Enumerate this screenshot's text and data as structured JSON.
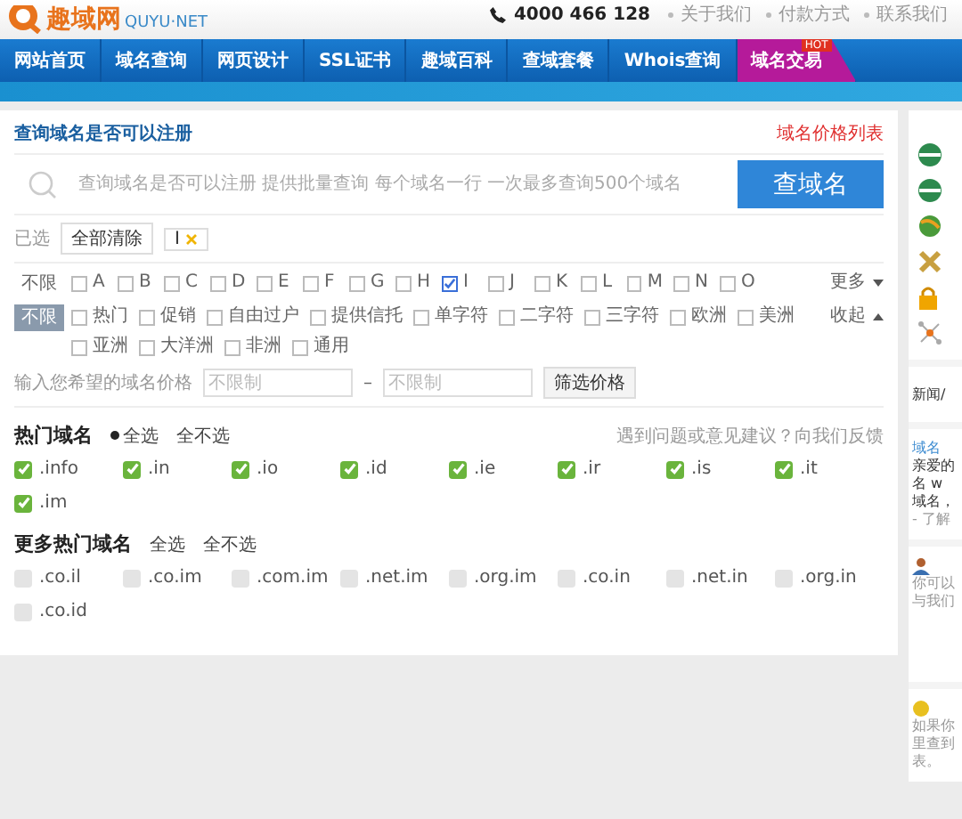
{
  "header": {
    "logo_text": "趣域网",
    "logo_sub": "QUYU·NET",
    "phone": "4000 466 128",
    "links": [
      "关于我们",
      "付款方式",
      "联系我们"
    ]
  },
  "nav": [
    {
      "label": "网站首页",
      "selected": false
    },
    {
      "label": "域名查询",
      "selected": false
    },
    {
      "label": "网页设计",
      "selected": false
    },
    {
      "label": "SSL证书",
      "selected": false
    },
    {
      "label": "趣域百科",
      "selected": false
    },
    {
      "label": "查域套餐",
      "selected": false
    },
    {
      "label": "Whois查询",
      "selected": false
    },
    {
      "label": "域名交易",
      "selected": true,
      "badge": "HOT"
    }
  ],
  "search": {
    "title": "查询域名是否可以注册",
    "price_link": "域名价格列表",
    "placeholder": "查询域名是否可以注册 提供批量查询 每个域名一行 一次最多查询500个域名",
    "button": "查域名"
  },
  "selected_filters": {
    "label": "已选",
    "clear": "全部清除",
    "tags": [
      "I"
    ]
  },
  "letter_filter": {
    "any": {
      "label": "不限",
      "selected": false
    },
    "toggle": {
      "label": "更多",
      "expanded": false
    },
    "items": [
      {
        "label": "A",
        "checked": false
      },
      {
        "label": "B",
        "checked": false
      },
      {
        "label": "C",
        "checked": false
      },
      {
        "label": "D",
        "checked": false
      },
      {
        "label": "E",
        "checked": false
      },
      {
        "label": "F",
        "checked": false
      },
      {
        "label": "G",
        "checked": false
      },
      {
        "label": "H",
        "checked": false
      },
      {
        "label": "I",
        "checked": true
      },
      {
        "label": "J",
        "checked": false
      },
      {
        "label": "K",
        "checked": false
      },
      {
        "label": "L",
        "checked": false
      },
      {
        "label": "M",
        "checked": false
      },
      {
        "label": "N",
        "checked": false
      },
      {
        "label": "O",
        "checked": false
      }
    ]
  },
  "category_filter": {
    "any": {
      "label": "不限",
      "selected": true
    },
    "toggle": {
      "label": "收起",
      "expanded": true
    },
    "items": [
      {
        "label": "热门",
        "checked": false
      },
      {
        "label": "促销",
        "checked": false
      },
      {
        "label": "自由过户",
        "checked": false
      },
      {
        "label": "提供信托",
        "checked": false
      },
      {
        "label": "单字符",
        "checked": false
      },
      {
        "label": "二字符",
        "checked": false
      },
      {
        "label": "三字符",
        "checked": false
      },
      {
        "label": "欧洲",
        "checked": false
      },
      {
        "label": "美洲",
        "checked": false
      },
      {
        "label": "亚洲",
        "checked": false
      },
      {
        "label": "大洋洲",
        "checked": false
      },
      {
        "label": "非洲",
        "checked": false
      },
      {
        "label": "通用",
        "checked": false
      }
    ]
  },
  "price_filter": {
    "label": "输入您希望的域名价格",
    "min_placeholder": "不限制",
    "separator": "–",
    "max_placeholder": "不限制",
    "button": "筛选价格"
  },
  "hot_domains": {
    "title": "热门域名",
    "options": [
      {
        "label": "全选",
        "selected": true
      },
      {
        "label": "全不选",
        "selected": false
      }
    ],
    "feedback": "遇到问题或意见建议？向我们反馈",
    "items": [
      {
        "label": ".info",
        "checked": true
      },
      {
        "label": ".in",
        "checked": true
      },
      {
        "label": ".io",
        "checked": true
      },
      {
        "label": ".id",
        "checked": true
      },
      {
        "label": ".ie",
        "checked": true
      },
      {
        "label": ".ir",
        "checked": true
      },
      {
        "label": ".is",
        "checked": true
      },
      {
        "label": ".it",
        "checked": true
      },
      {
        "label": ".im",
        "checked": true
      }
    ]
  },
  "more_domains": {
    "title": "更多热门域名",
    "options": [
      {
        "label": "全选",
        "selected": false
      },
      {
        "label": "全不选",
        "selected": false
      }
    ],
    "items": [
      {
        "label": ".co.il",
        "checked": false
      },
      {
        "label": ".co.im",
        "checked": false
      },
      {
        "label": ".com.im",
        "checked": false
      },
      {
        "label": ".net.im",
        "checked": false
      },
      {
        "label": ".org.im",
        "checked": false
      },
      {
        "label": ".co.in",
        "checked": false
      },
      {
        "label": ".net.in",
        "checked": false
      },
      {
        "label": ".org.in",
        "checked": false
      },
      {
        "label": ".co.id",
        "checked": false
      }
    ]
  },
  "sidebar": {
    "news_title": "新闻/",
    "news_link": "域名",
    "news_lines": [
      "亲爱的",
      "名 w",
      "域名，"
    ],
    "news_more": "- 了解",
    "contact_lines": [
      "你可以",
      "与我们"
    ],
    "help_lines": [
      "如果你",
      "里查到",
      "表。"
    ]
  }
}
